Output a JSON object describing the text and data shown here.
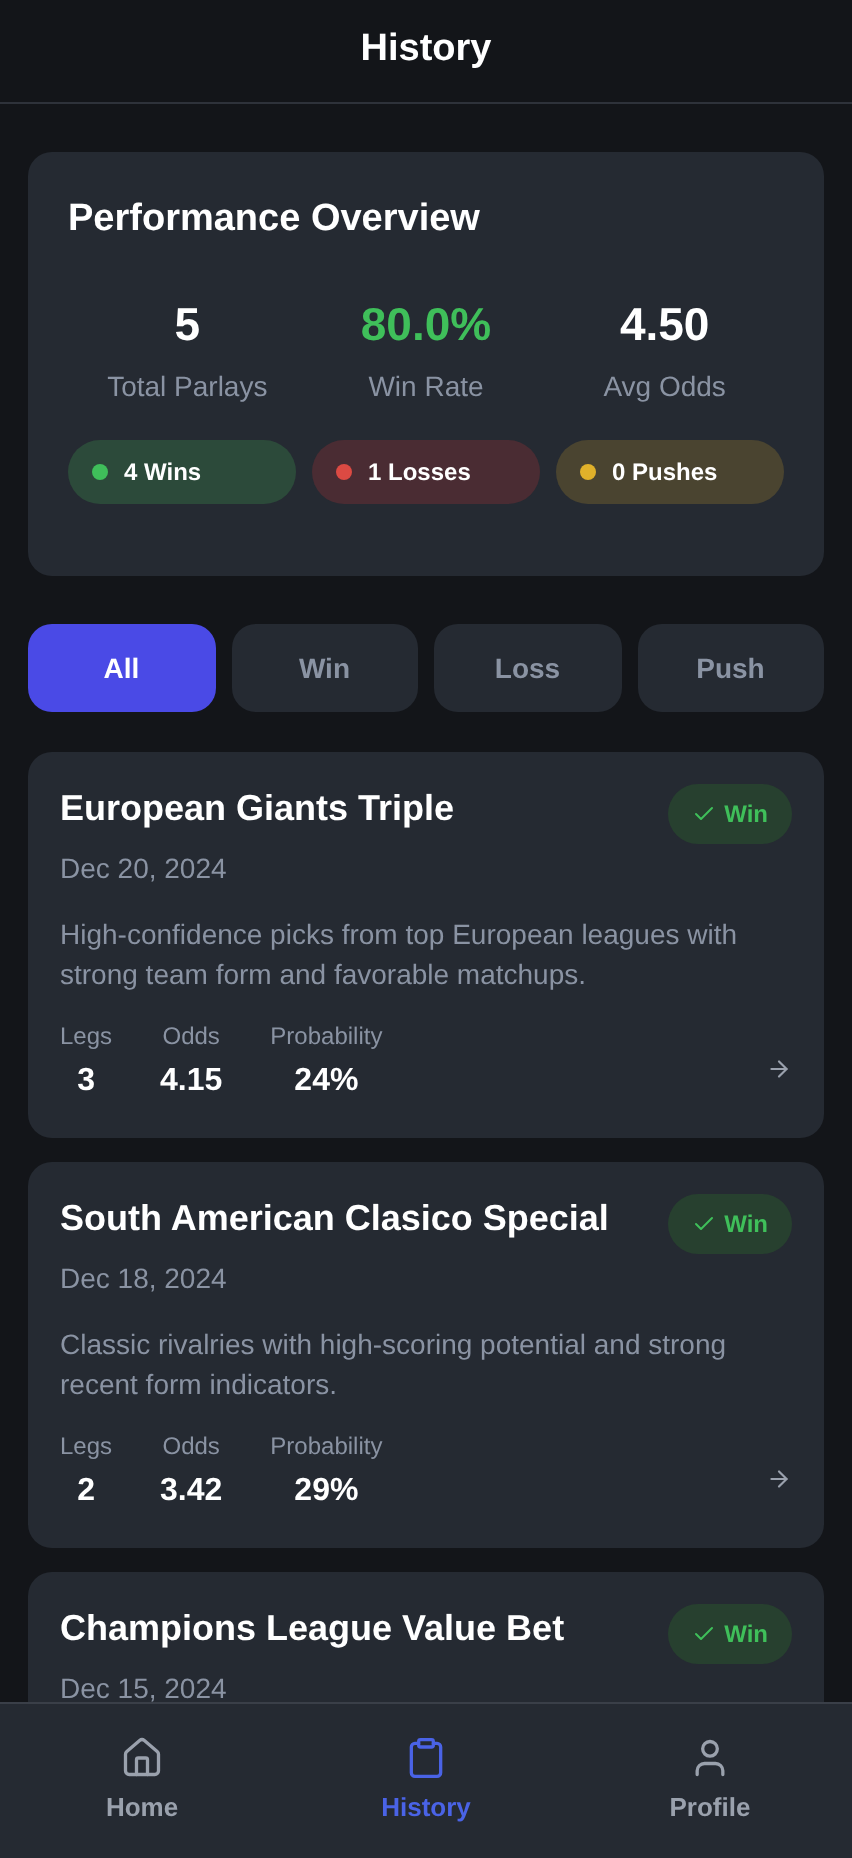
{
  "header": {
    "title": "History"
  },
  "overview": {
    "title": "Performance Overview",
    "stats": [
      {
        "value": "5",
        "label": "Total Parlays",
        "kind": "plain"
      },
      {
        "value": "80.0%",
        "label": "Win Rate",
        "kind": "positive"
      },
      {
        "value": "4.50",
        "label": "Avg Odds",
        "kind": "plain"
      }
    ],
    "tallies": [
      {
        "text": "4 Wins",
        "color": "#3fbf5a",
        "kind": "win"
      },
      {
        "text": "1 Losses",
        "color": "#dc4a43",
        "kind": "loss"
      },
      {
        "text": "0 Pushes",
        "color": "#e0b12a",
        "kind": "push"
      }
    ]
  },
  "filters": [
    {
      "label": "All",
      "selected": true
    },
    {
      "label": "Win",
      "selected": false
    },
    {
      "label": "Loss",
      "selected": false
    },
    {
      "label": "Push",
      "selected": false
    }
  ],
  "parlays": [
    {
      "title": "European Giants Triple",
      "date": "Dec 20, 2024",
      "result": "Win",
      "kind": "win",
      "description": "High-confidence picks from top European leagues with strong team form and favorable matchups.",
      "stats": [
        {
          "label": "Legs",
          "value": "3"
        },
        {
          "label": "Odds",
          "value": "4.15"
        },
        {
          "label": "Probability",
          "value": "24%"
        }
      ]
    },
    {
      "title": "South American Clasico Special",
      "date": "Dec 18, 2024",
      "result": "Win",
      "kind": "win",
      "description": "Classic rivalries with high-scoring potential and strong recent form indicators.",
      "stats": [
        {
          "label": "Legs",
          "value": "2"
        },
        {
          "label": "Odds",
          "value": "3.42"
        },
        {
          "label": "Probability",
          "value": "29%"
        }
      ]
    },
    {
      "title": "Champions League Value Bet",
      "date": "Dec 15, 2024",
      "result": "Win",
      "kind": "win"
    }
  ],
  "nav": [
    {
      "label": "Home",
      "kind": "home",
      "selected": false
    },
    {
      "label": "History",
      "kind": "history",
      "selected": true
    },
    {
      "label": "Profile",
      "kind": "profile",
      "selected": false
    }
  ]
}
